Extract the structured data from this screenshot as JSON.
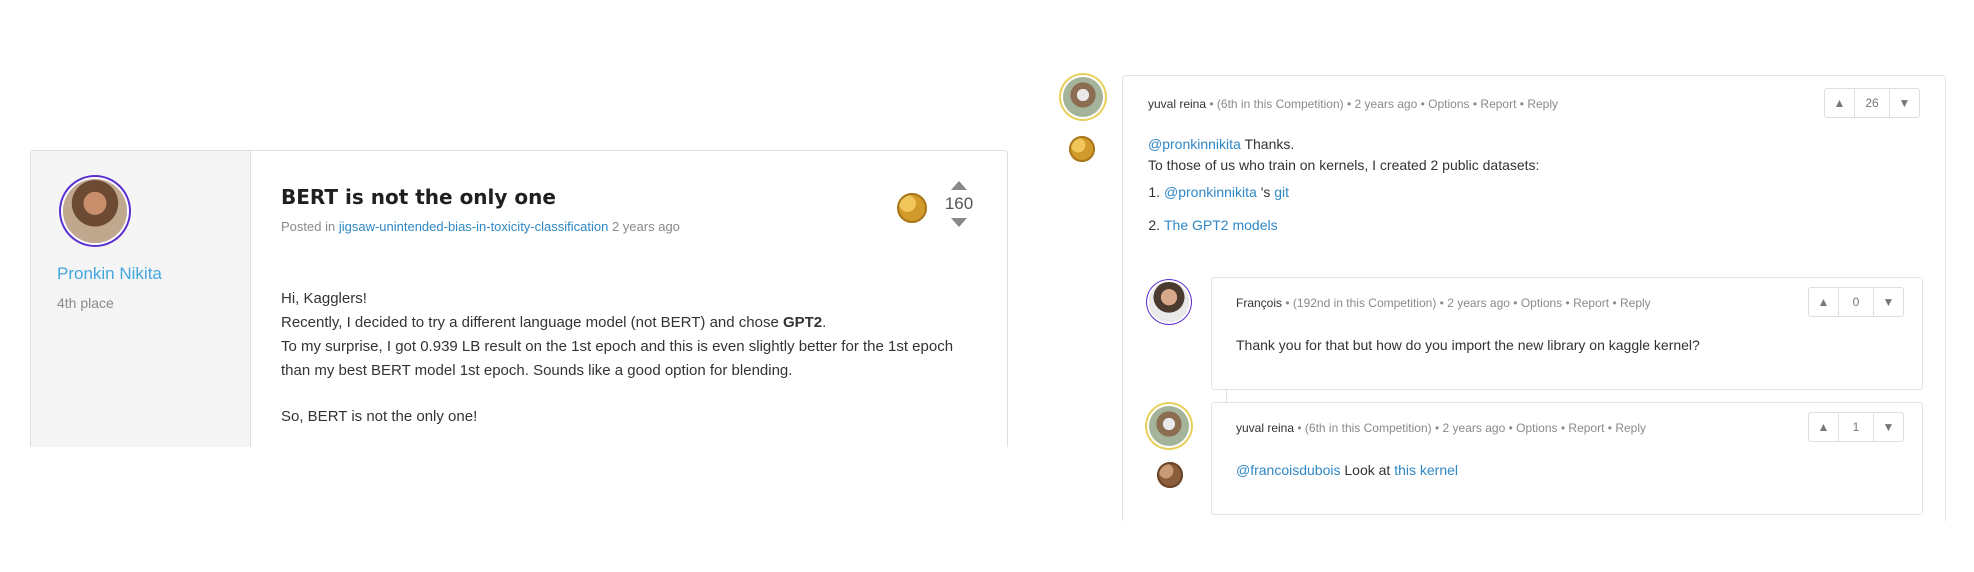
{
  "post": {
    "author_name": "Pronkin Nikita",
    "author_rank": "4th place",
    "title": "BERT is not the only one",
    "meta_prefix": "Posted in",
    "meta_competition": "jigsaw-unintended-bias-in-toxicity-classification",
    "meta_time": "2 years ago",
    "vote_count": "160",
    "body": {
      "line1": "Hi, Kagglers!",
      "line2_prefix": "Recently, I decided to try a different language model (not BERT) and chose ",
      "line2_bold": "GPT2",
      "line2_suffix": ".",
      "line3": "To my surprise, I got 0.939 LB result on the 1st epoch and this is even slightly better for the 1st epoch than my best BERT model 1st epoch. Sounds like a good option for blending.",
      "line4": "So, BERT is not the only one!"
    }
  },
  "comments": [
    {
      "author": "yuval reina",
      "rank": "(6th in this Competition)",
      "time": "2 years ago",
      "actions": [
        "Options",
        "Report",
        "Reply"
      ],
      "votes": "26",
      "mention": "@pronkinnikita",
      "text1": " Thanks.",
      "text2": "To those of us who train on kernels, I created 2 public datasets:",
      "list": [
        {
          "link1": "@pronkinnikita",
          "text": " 's ",
          "link2": "git"
        },
        {
          "link1": "The GPT2 models"
        }
      ]
    },
    {
      "author": "François",
      "rank": "(192nd in this Competition)",
      "time": "2 years ago",
      "actions": [
        "Options",
        "Report",
        "Reply"
      ],
      "votes": "0",
      "text": "Thank you for that but how do you import the new library on kaggle kernel?"
    },
    {
      "author": "yuval reina",
      "rank": "(6th in this Competition)",
      "time": "2 years ago",
      "actions": [
        "Options",
        "Report",
        "Reply"
      ],
      "votes": "1",
      "mention": "@francoisdubois",
      "text": " Look at ",
      "link": "this kernel"
    }
  ],
  "icons": {
    "upvote": "chevron-up-icon",
    "downvote": "chevron-down-icon",
    "medal_gold": "gold-medal-icon",
    "medal_bronze": "bronze-medal-icon"
  },
  "colors": {
    "link": "#2f87c5",
    "author": "#44a6df",
    "gold": "#d19a2a",
    "bronze": "#8c5d3a",
    "tier_ring": "#5b2fcf"
  }
}
